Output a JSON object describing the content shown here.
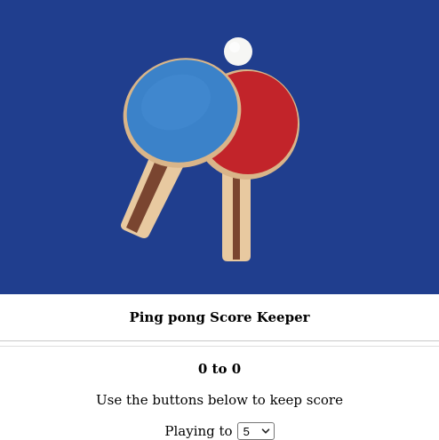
{
  "hero": {
    "icon": "ping-pong-paddles-image",
    "colors": {
      "table": "#1f3f8f",
      "blue_rubber": "#3b82c9",
      "red_rubber": "#c8262c",
      "handle_wood": "#e8c9a0",
      "handle_dark": "#7a4530",
      "ball": "#f6f6f4"
    }
  },
  "app": {
    "title": "Ping pong Score Keeper"
  },
  "score": {
    "player1": "0",
    "separator": "to",
    "player2": "0"
  },
  "instructions": "Use the buttons below to keep score",
  "playing_to": {
    "label": "Playing to",
    "selected": "5"
  }
}
